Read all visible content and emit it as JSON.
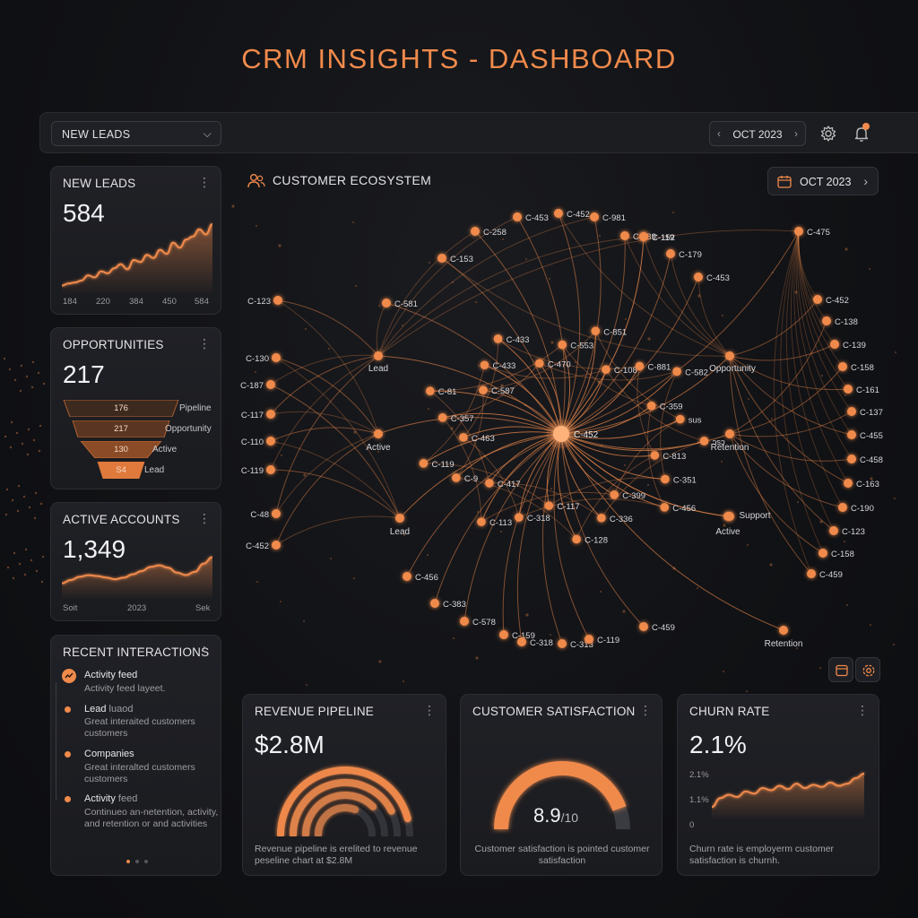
{
  "header": {
    "title": "CRM INSIGHTS - DASHBOARD"
  },
  "toolbar": {
    "filter_value": "NEW LEADS",
    "month": "OCT 2023",
    "icons": [
      "chevron-left-icon",
      "chevron-right-icon",
      "settings-icon",
      "bell-icon"
    ]
  },
  "colors": {
    "accent": "#f08a4b",
    "background": "#111215",
    "card": "#1e1f24"
  },
  "new_leads": {
    "title": "NEW LEADS",
    "value": "584",
    "ticks": [
      "184",
      "220",
      "384",
      "450",
      "584"
    ],
    "chart_data": {
      "type": "area",
      "x": [
        "184",
        "220",
        "384",
        "450",
        "584"
      ],
      "series": [
        {
          "values": [
            10,
            12,
            13,
            15,
            20,
            18,
            24,
            22,
            27,
            31,
            26,
            35,
            33,
            40,
            37,
            45,
            41,
            52,
            47,
            55,
            58,
            65,
            60,
            70
          ]
        }
      ]
    }
  },
  "opportunities": {
    "title": "OPPORTUNITIES",
    "value": "217",
    "funnel": [
      {
        "value": "176",
        "label": "Pipeline"
      },
      {
        "value": "217",
        "label": "Opportunity"
      },
      {
        "value": "130",
        "label": "Active"
      },
      {
        "value": "S4",
        "label": "Lead"
      }
    ]
  },
  "active_accounts": {
    "title": "ACTIVE ACCOUNTS",
    "value": "1,349",
    "ticks": [
      "Soit",
      "2023",
      "Sek"
    ],
    "chart_data": {
      "type": "area",
      "series": [
        {
          "values": [
            20,
            24,
            28,
            30,
            29,
            27,
            25,
            27,
            31,
            35,
            40,
            42,
            39,
            33,
            30,
            34,
            44,
            52
          ]
        }
      ]
    }
  },
  "recent_interactions": {
    "title": "RECENT INTERACTIONS",
    "items": [
      {
        "title": "Activity feed",
        "desc": "Activity feed layeet."
      },
      {
        "title": "Lead",
        "title_suffix": "luaod",
        "desc": "Great interaited customers customers"
      },
      {
        "title": "Companies",
        "desc": "Great interalted customers customers"
      },
      {
        "title": "Activity",
        "title_suffix": "feed",
        "desc": "Continueo an-netention, activity, and retention or and activities"
      }
    ]
  },
  "ecosystem": {
    "title": "CUSTOMER ECOSYSTEM",
    "month": "OCT 2023",
    "center_label": "C-452",
    "hubs": [
      "Lead",
      "Active",
      "Lead",
      "Opportunity",
      "Retention",
      "Support",
      "Active",
      "Retention"
    ],
    "nodes_left": [
      "C-123",
      "C-130",
      "C-187",
      "C-117",
      "C-110",
      "C-119",
      "C-48",
      "C-452"
    ],
    "nodes_top": [
      "C-453",
      "C-452",
      "C-981",
      "C-189",
      "C-119",
      "C-179",
      "C-258",
      "C-153",
      "C-581",
      "C-453",
      "C-475",
      "C-152"
    ],
    "nodes_right": [
      "C-452",
      "C-138",
      "C-139",
      "C-158",
      "C-161",
      "C-137",
      "C-455",
      "C-458",
      "C-163",
      "C-190",
      "C-123",
      "C-158",
      "C-459"
    ],
    "nodes_inner": [
      "C-813",
      "C-351",
      "C-456",
      "C-399",
      "C-336",
      "C-128",
      "C-117",
      "C-318",
      "C-113",
      "C-417",
      "C-9",
      "C-119",
      "C-463",
      "C-357",
      "C-81",
      "C-587",
      "C-433",
      "C-433",
      "C-470",
      "C-553",
      "C-851",
      "C-108",
      "C-881",
      "C-582",
      "C-359",
      "sus",
      "ɔsɔ"
    ],
    "nodes_bottom": [
      "C-456",
      "C-383",
      "C-578",
      "C-159",
      "C-318",
      "C-313",
      "C-119",
      "C-459"
    ]
  },
  "revenue_pipeline": {
    "title": "REVENUE PIPELINE",
    "value": "$2.8M",
    "progress": [
      0.62,
      0.75,
      0.85,
      0.92
    ],
    "desc": "Revenue pipeline is erelited to revenue peseline chart at $2.8M"
  },
  "customer_satisfaction": {
    "title": "CUSTOMER SATISFACTION",
    "score": "8.9",
    "max": "/10",
    "fraction": 0.89,
    "desc": "Customer satisfaction is pointed customer satisfaction"
  },
  "churn_rate": {
    "title": "CHURN RATE",
    "value": "2.1%",
    "ticks": [
      "2.1%",
      "1.1%",
      "0"
    ],
    "chart_data": {
      "type": "line",
      "series": [
        {
          "values": [
            0.6,
            1.0,
            1.15,
            1.05,
            1.3,
            1.2,
            1.45,
            1.35,
            1.55,
            1.4,
            1.65,
            1.45,
            1.6,
            1.5,
            1.7,
            1.55,
            1.65,
            1.9,
            2.1
          ]
        }
      ],
      "ylim": [
        0,
        2.5
      ]
    },
    "desc": "Churn rate is employerm customer satisfaction is churnh."
  }
}
